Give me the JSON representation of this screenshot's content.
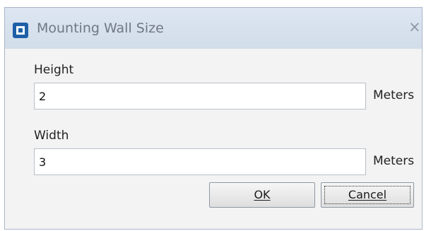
{
  "window": {
    "title": "Mounting Wall Size",
    "close_glyph": "×",
    "app_icon": "app-icon",
    "close_icon": "close-icon"
  },
  "height_field": {
    "label": "Height",
    "value": "2",
    "unit": "Meters"
  },
  "width_field": {
    "label": "Width",
    "value": "3",
    "unit": "Meters"
  },
  "buttons": {
    "ok_label": "OK",
    "cancel_label": "Cancel"
  },
  "colors": {
    "titlebar": "#d6e0ec",
    "dialog_background": "#f3f3f3",
    "app_icon": "#1f5fa7"
  }
}
